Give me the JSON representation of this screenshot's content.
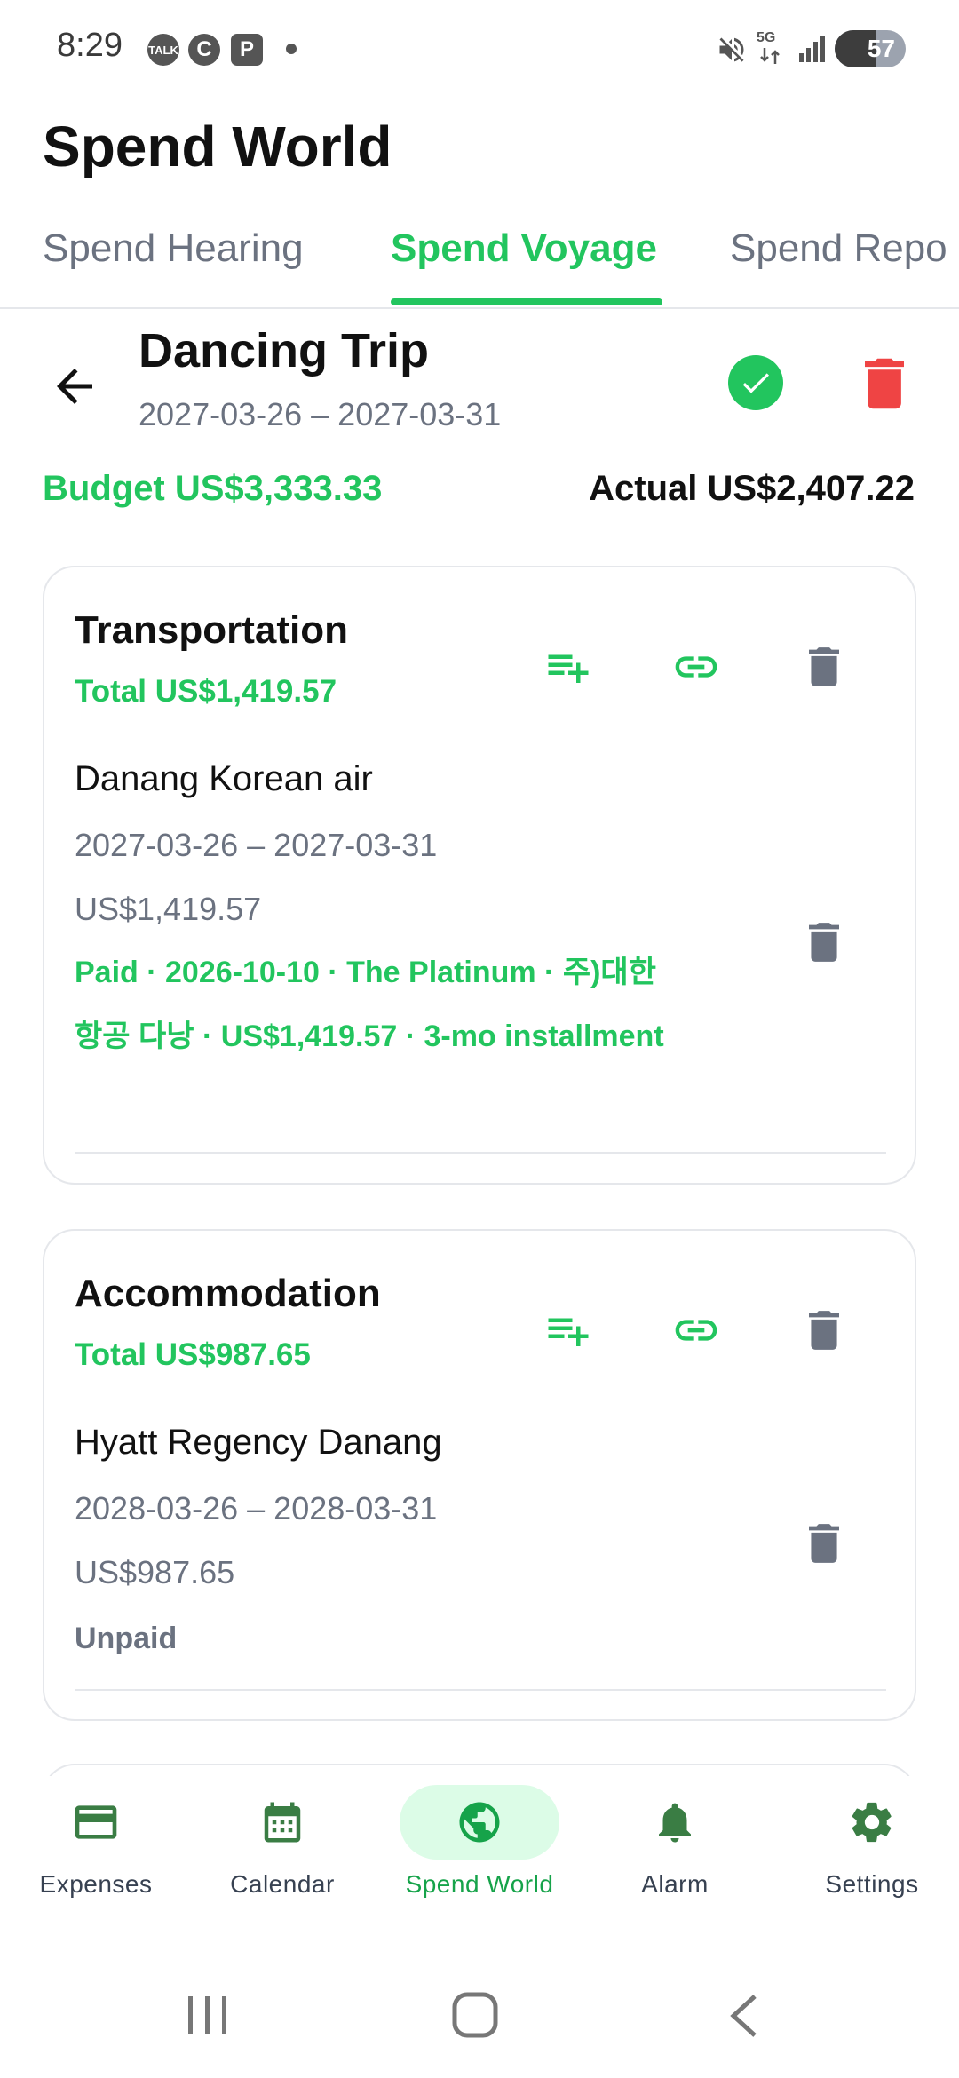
{
  "status_bar": {
    "time": "8:29",
    "notif_talk": "TALK",
    "notif_c": "C",
    "notif_p": "P",
    "network": "5G",
    "battery": "57"
  },
  "app": {
    "title": "Spend World",
    "tabs": [
      {
        "label": "Spend Hearing",
        "active": false
      },
      {
        "label": "Spend Voyage",
        "active": true
      },
      {
        "label": "Spend Repo",
        "active": false
      }
    ]
  },
  "trip": {
    "name": "Dancing Trip",
    "dates": "2027-03-26 – 2027-03-31",
    "budget": "Budget US$3,333.33",
    "actual": "Actual US$2,407.22"
  },
  "categories": [
    {
      "name": "Transportation",
      "total": "Total US$1,419.57",
      "items": [
        {
          "name": "Danang Korean air",
          "dates": "2027-03-26 – 2027-03-31",
          "amount": "US$1,419.57",
          "payment": "Paid · 2026-10-10 · The Platinum · 주)대한항공 다낭 · US$1,419.57 · 3-mo installment",
          "paid": true
        }
      ]
    },
    {
      "name": "Accommodation",
      "total": "Total US$987.65",
      "items": [
        {
          "name": "Hyatt Regency Danang",
          "dates": "2028-03-26 – 2028-03-31",
          "amount": "US$987.65",
          "payment": "Unpaid",
          "paid": false
        }
      ]
    }
  ],
  "bottom_nav": [
    {
      "label": "Expenses",
      "icon": "credit-card-icon",
      "active": false
    },
    {
      "label": "Calendar",
      "icon": "calendar-icon",
      "active": false
    },
    {
      "label": "Spend World",
      "icon": "globe-icon",
      "active": true
    },
    {
      "label": "Alarm",
      "icon": "bell-icon",
      "active": false
    },
    {
      "label": "Settings",
      "icon": "gear-icon",
      "active": false
    }
  ],
  "colors": {
    "accent": "#22c55e",
    "accent_dark": "#3a7d44",
    "danger": "#ef4444",
    "muted": "#6b7280"
  }
}
